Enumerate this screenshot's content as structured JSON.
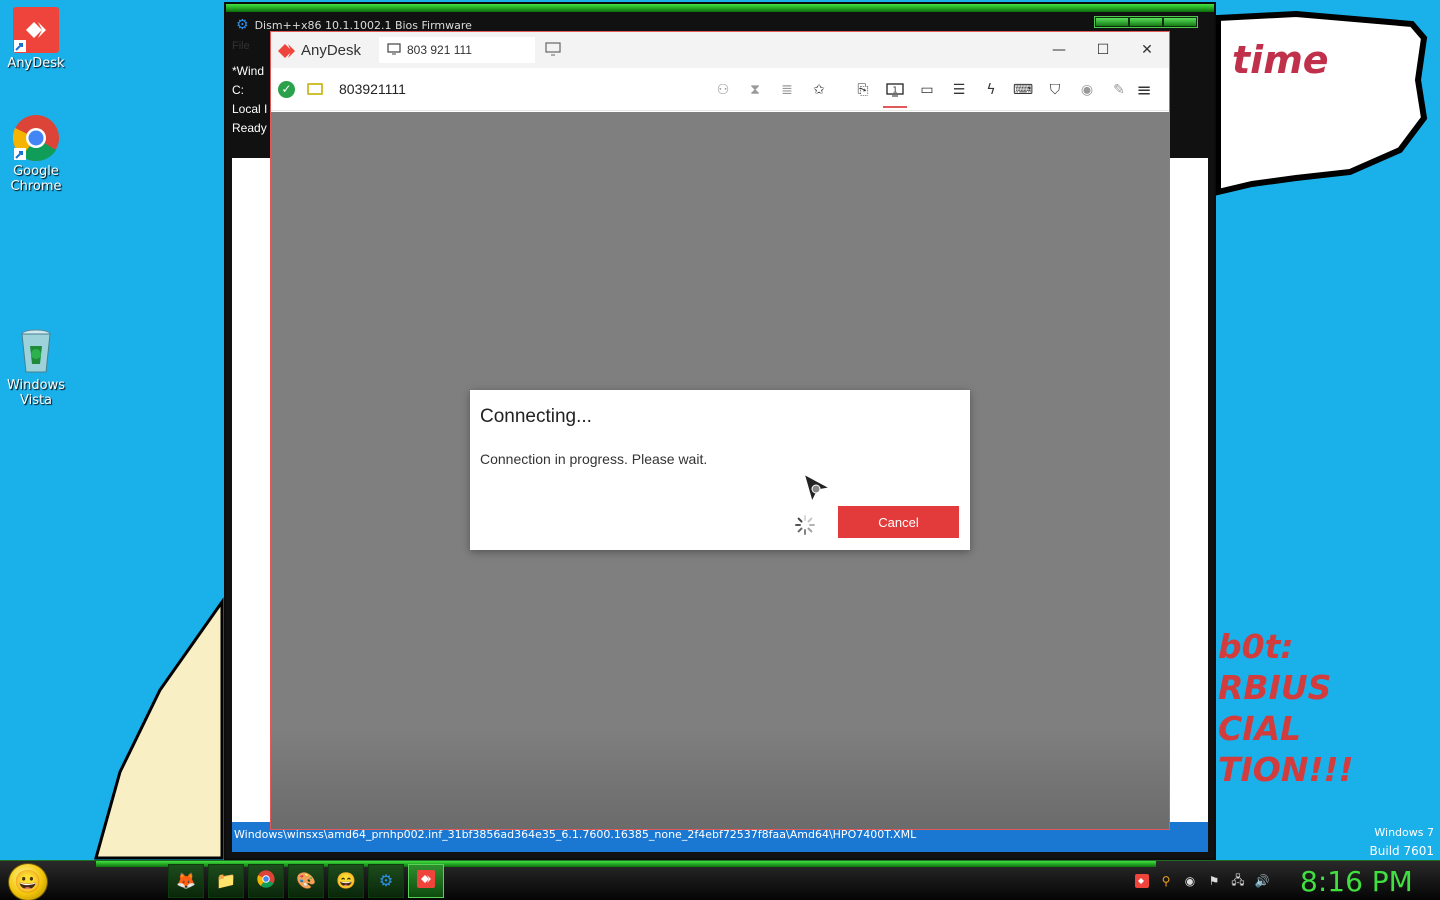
{
  "wallpaper": {
    "bubble_text": "time",
    "lines": [
      "b0t:",
      "RBIUS",
      "CIAL",
      "TION!!!"
    ],
    "watermark": [
      "Windows 7",
      "Build 7601"
    ]
  },
  "desktop_icons": [
    {
      "label": "AnyDesk"
    },
    {
      "label": "Google\nChrome"
    },
    {
      "label": "Windows\nVista"
    }
  ],
  "dism": {
    "title": "Dism++x86 10.1.1002.1 Bios Firmware",
    "menu": "File",
    "info_lines": [
      "*Wind",
      "C:",
      "Local I",
      "Ready"
    ],
    "status_path": "Windows\\winsxs\\amd64_prnhp002.inf_31bf3856ad364e35_6.1.7600.16385_none_2f4ebf72537f8faa\\Amd64\\HPO7400T.XML"
  },
  "anydesk": {
    "app_name": "AnyDesk",
    "tab_label": "803 921 111",
    "address": "803921111",
    "window_controls": {
      "minimize": "—",
      "maximize": "☐",
      "close": "✕"
    },
    "toolbar_icons": [
      "incognito-icon",
      "hourglass-icon",
      "database-icon",
      "favorite-icon",
      "file-transfer-icon",
      "monitor-1-icon",
      "display-icon",
      "chat-icon",
      "actions-icon",
      "keyboard-icon",
      "permissions-icon",
      "record-icon",
      "whiteboard-icon"
    ],
    "dialog": {
      "title": "Connecting...",
      "message": "Connection in progress. Please wait.",
      "cancel_label": "Cancel"
    }
  },
  "taskbar": {
    "clock": "8:16 PM",
    "items": [
      "firefox",
      "explorer",
      "chrome",
      "paint",
      "smiley",
      "dism",
      "anydesk"
    ],
    "tray": [
      "anydesk-tray-icon",
      "search-tray-icon",
      "help-tray-icon",
      "flag-tray-icon",
      "network-tray-icon",
      "volume-tray-icon"
    ]
  },
  "colors": {
    "desktop": "#1ab0ea",
    "anydesk_red": "#e33b3b",
    "green_theme": "#3fe03f"
  }
}
